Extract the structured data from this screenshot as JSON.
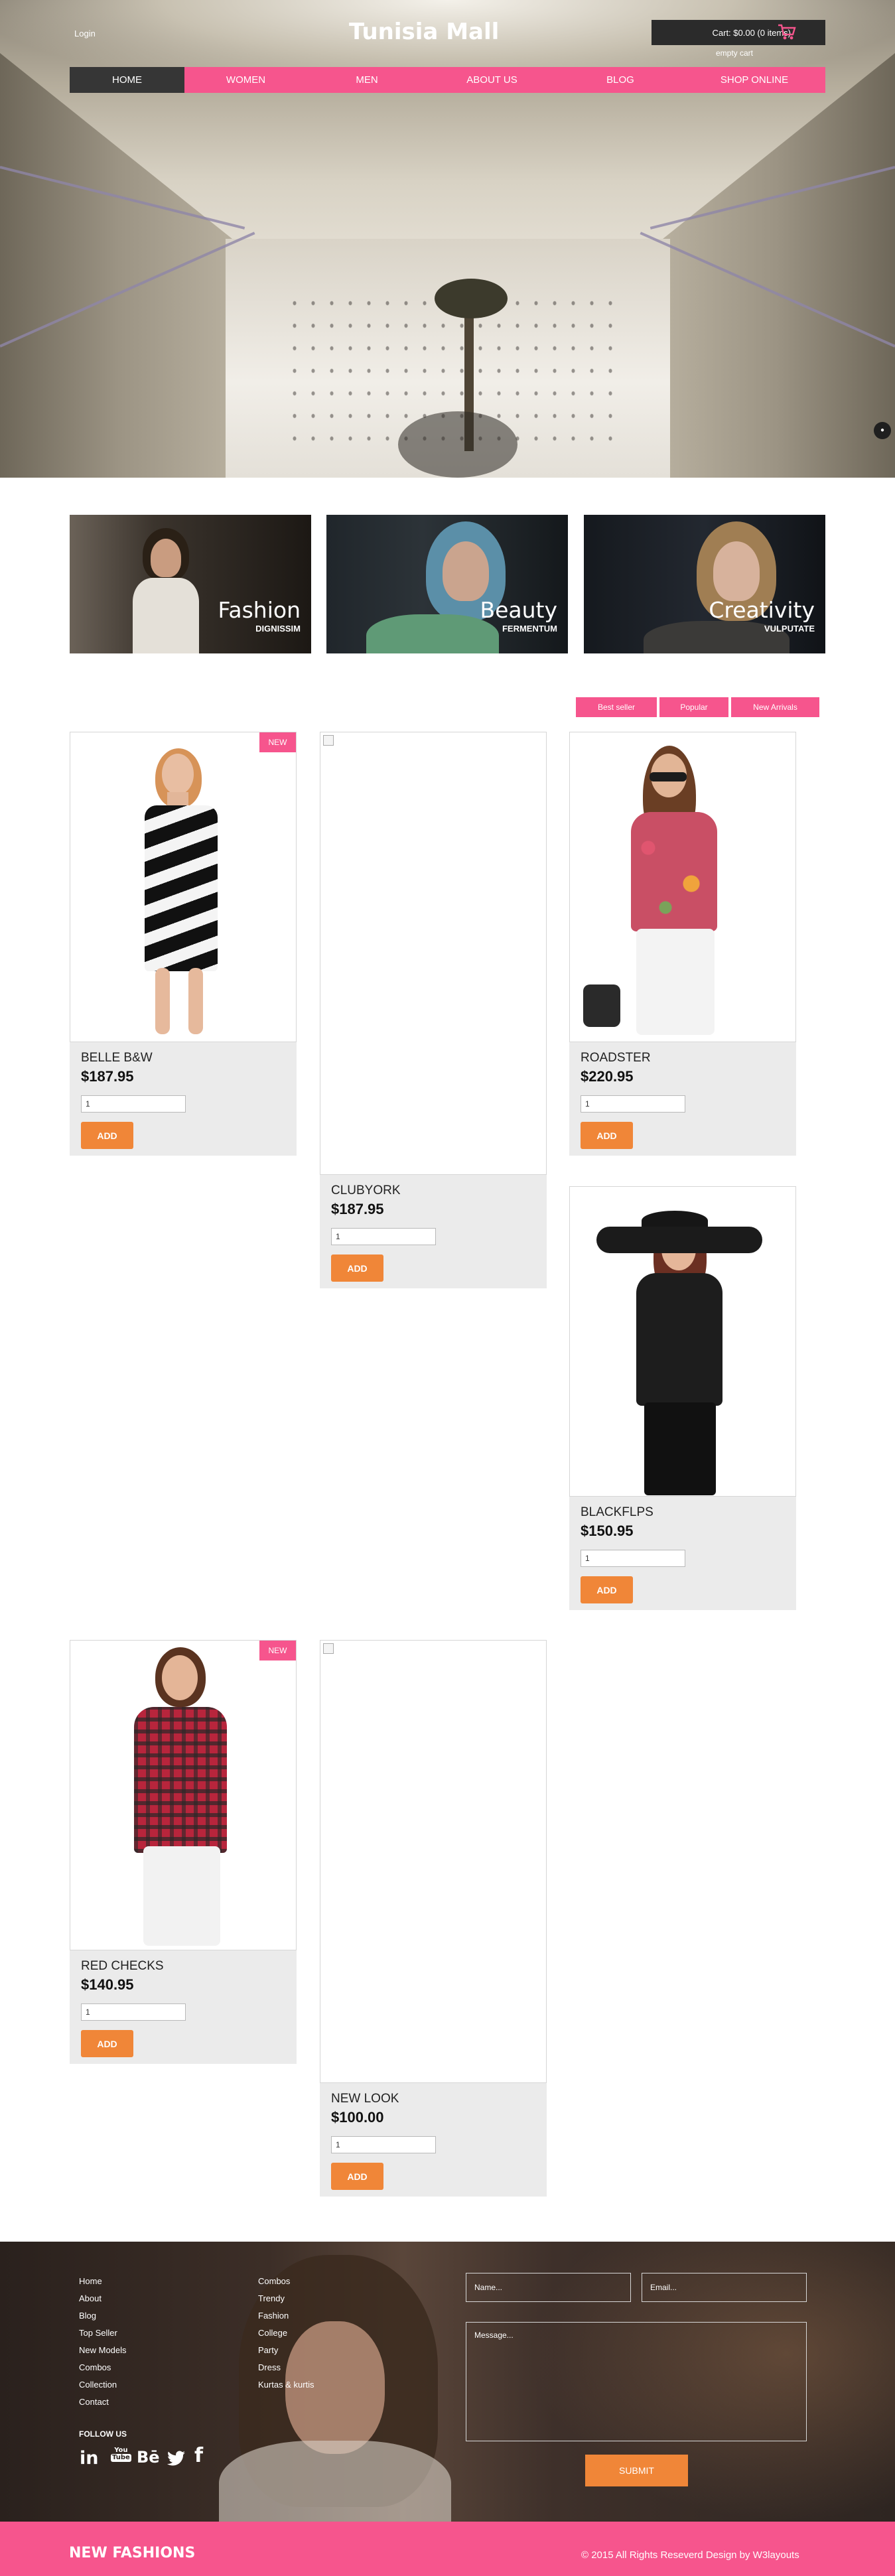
{
  "header": {
    "login_label": "Login",
    "brand": "Tunisia Mall",
    "cart_summary": "Cart: $0.00 (0 items)",
    "empty_cart_label": "empty cart"
  },
  "nav": {
    "items": [
      "HOME",
      "WOMEN",
      "MEN",
      "ABOUT US",
      "BLOG",
      "SHOP ONLINE"
    ],
    "active_index": 0
  },
  "banners": [
    {
      "title": "Fashion",
      "subtitle": "DIGNISSIM"
    },
    {
      "title": "Beauty",
      "subtitle": "FERMENTUM"
    },
    {
      "title": "Creativity",
      "subtitle": "VULPUTATE"
    }
  ],
  "filters": [
    "Best seller",
    "Popular",
    "New Arrivals"
  ],
  "products": [
    {
      "name": "BELLE B&W",
      "price": "$187.95",
      "qty": "1",
      "badge": "NEW",
      "add_label": "ADD"
    },
    {
      "name": "CLUBYORK",
      "price": "$187.95",
      "qty": "1",
      "add_label": "ADD"
    },
    {
      "name": "ROADSTER",
      "price": "$220.95",
      "qty": "1",
      "add_label": "ADD"
    },
    {
      "name": "BLACKFLPS",
      "price": "$150.95",
      "qty": "1",
      "add_label": "ADD"
    },
    {
      "name": "RED CHECKS",
      "price": "$140.95",
      "qty": "1",
      "badge": "NEW",
      "add_label": "ADD"
    },
    {
      "name": "NEW LOOK",
      "price": "$100.00",
      "qty": "1",
      "add_label": "ADD"
    }
  ],
  "footer": {
    "links_col1": [
      "Home",
      "About",
      "Blog",
      "Top Seller",
      "New Models",
      "Combos",
      "Collection",
      "Contact"
    ],
    "links_col2": [
      "Combos",
      "Trendy",
      "Fashion",
      "College",
      "Party",
      "Dress",
      "Kurtas & kurtis"
    ],
    "follow_label": "FOLLOW US",
    "social": {
      "linkedin": "in",
      "youtube_top": "You",
      "youtube_bottom": "Tube",
      "behance": "Bē",
      "facebook": "f"
    },
    "form": {
      "name_placeholder": "Name...",
      "email_placeholder": "Email...",
      "message_placeholder": "Message...",
      "submit_label": "SUBMIT"
    },
    "bottom_brand": "NEW FASHIONS",
    "copyright": "© 2015 All Rights Reseverd Design by W3layouts"
  },
  "colors": {
    "accent_pink": "#f6558d",
    "accent_orange": "#f08638",
    "nav_active": "#363636",
    "card_bg": "#ebebeb"
  }
}
